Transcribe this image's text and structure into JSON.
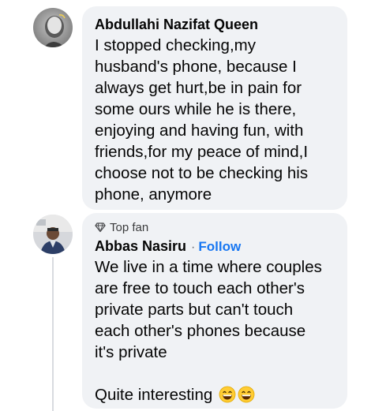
{
  "comments": [
    {
      "author": "Abdullahi Nazifat Queen",
      "text_lines": [
        "I stopped checking,my",
        "husband's phone, because I",
        "always get hurt,be in pain for",
        "some ours while he is there,",
        "enjoying and having fun, with",
        "friends,for my peace of mind,I",
        "choose not to be checking his",
        "phone, anymore"
      ]
    },
    {
      "badge": "Top fan",
      "badge_icon": "diamond-icon",
      "author": "Abbas Nasiru",
      "separator": "·",
      "follow_label": "Follow",
      "text_lines": [
        "We live in a time where couples",
        "are free to touch each other's",
        "private parts but can't touch",
        "each other's phones because",
        "it's private"
      ],
      "closing_line": "Quite interesting",
      "emojis": [
        "grinning-face-icon",
        "grinning-face-icon"
      ]
    }
  ],
  "colors": {
    "bubble": "#f0f2f5",
    "text": "#050505",
    "follow": "#1877f2",
    "muted": "#65676b"
  }
}
